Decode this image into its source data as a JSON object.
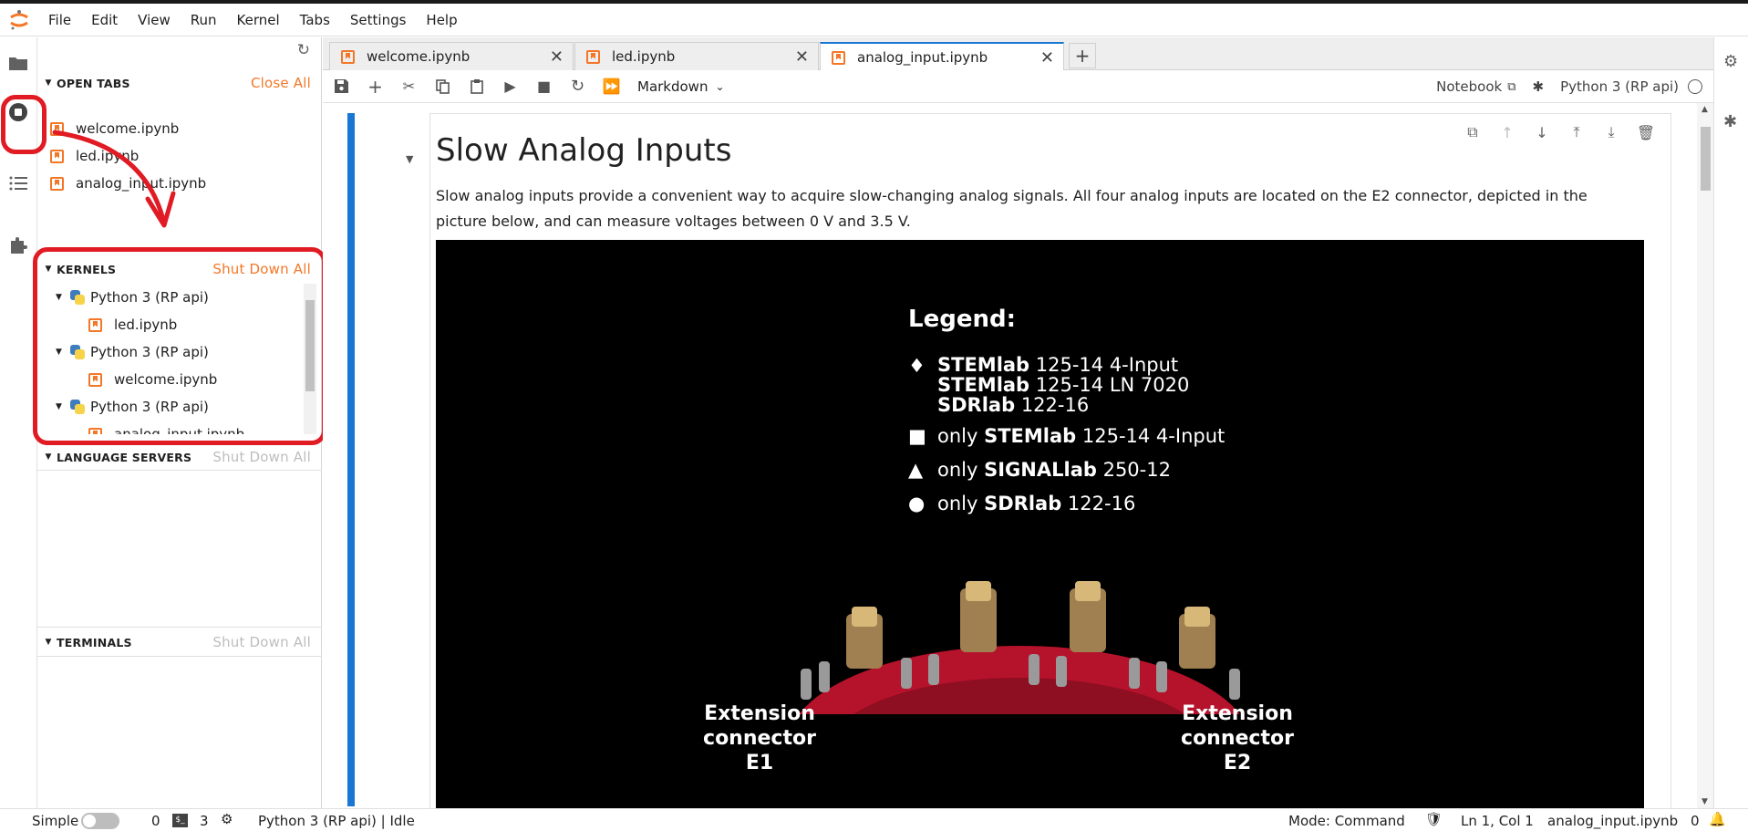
{
  "menu": [
    "File",
    "Edit",
    "View",
    "Run",
    "Kernel",
    "Tabs",
    "Settings",
    "Help"
  ],
  "left_bar_icons": [
    "folder-icon",
    "running-icon",
    "toc-icon",
    "extension-icon"
  ],
  "sidebar": {
    "open_tabs": {
      "title": "OPEN TABS",
      "action": "Close All",
      "items": [
        "welcome.ipynb",
        "led.ipynb",
        "analog_input.ipynb"
      ]
    },
    "kernels": {
      "title": "KERNELS",
      "action": "Shut Down All",
      "items": [
        {
          "kernel": "Python 3 (RP api)",
          "notebook": "led.ipynb"
        },
        {
          "kernel": "Python 3 (RP api)",
          "notebook": "welcome.ipynb"
        },
        {
          "kernel": "Python 3 (RP api)",
          "notebook": "analog_input.ipynb"
        }
      ]
    },
    "language_servers": {
      "title": "LANGUAGE SERVERS",
      "action": "Shut Down All"
    },
    "terminals": {
      "title": "TERMINALS",
      "action": "Shut Down All"
    }
  },
  "tabs": [
    {
      "label": "welcome.ipynb",
      "active": false
    },
    {
      "label": "led.ipynb",
      "active": false
    },
    {
      "label": "analog_input.ipynb",
      "active": true
    }
  ],
  "toolbar": {
    "cell_type": "Markdown",
    "notebook_label": "Notebook",
    "kernel_label": "Python 3 (RP api)"
  },
  "cell": {
    "heading": "Slow Analog Inputs",
    "paragraph": "Slow analog inputs provide a convenient way to acquire slow-changing analog signals. All four analog inputs are located on the E2 connector, depicted in the picture below, and can measure voltages between 0 V and 3.5 V.",
    "image": {
      "legend_title": "Legend:",
      "legend": [
        {
          "symbol": "♦",
          "lines": [
            {
              "bold": "STEMlab",
              "rest": " 125-14 4-Input"
            },
            {
              "bold": "STEMlab",
              "rest": " 125-14 LN 7020"
            },
            {
              "bold": "SDRlab",
              "rest": " 122-16"
            }
          ]
        },
        {
          "symbol": "■",
          "lines": [
            {
              "pre": "only ",
              "bold": "STEMlab",
              "rest": " 125-14 4-Input"
            }
          ]
        },
        {
          "symbol": "▲",
          "lines": [
            {
              "pre": "only ",
              "bold": "SIGNALlab",
              "rest": " 250-12"
            }
          ]
        },
        {
          "symbol": "●",
          "lines": [
            {
              "pre": "only ",
              "bold": "SDRlab",
              "rest": " 122-16"
            }
          ]
        }
      ],
      "left_connector": [
        "Extension",
        "connector",
        "E1"
      ],
      "right_connector": [
        "Extension",
        "connector",
        "E2"
      ]
    }
  },
  "status": {
    "mode_label": "Simple",
    "terminals": "0",
    "kernels": "3",
    "kernel_status": "Python 3 (RP api) | Idle",
    "mode": "Mode: Command",
    "position": "Ln 1, Col 1",
    "file": "analog_input.ipynb",
    "notifications": "0"
  },
  "colors": {
    "accent": "#f37726",
    "active": "#1976d2",
    "annotation": "#e01b24"
  }
}
